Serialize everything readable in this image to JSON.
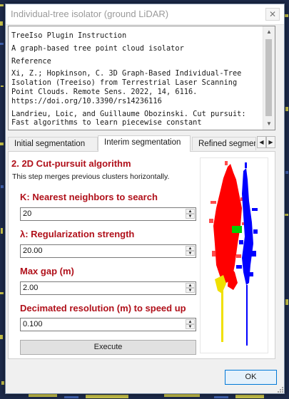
{
  "window": {
    "title": "Individual-tree isolator (ground LiDAR)",
    "close_glyph": "✕"
  },
  "info": {
    "lines": [
      "TreeIso Plugin Instruction",
      "A graph-based tree point cloud isolator",
      "Reference",
      "Xi, Z.; Hopkinson, C. 3D Graph-Based Individual-Tree Isolation (Treeiso) from Terrestrial Laser Scanning Point Clouds. Remote Sens. 2022, 14, 6116. https://doi.org/10.3390/rs14236116",
      "Landrieu, Loic, and Guillaume Obozinski. Cut pursuit: Fast algorithms to learn piecewise constant"
    ]
  },
  "tabs": [
    {
      "label": "Initial segmentation",
      "active": false
    },
    {
      "label": "Interim segmentation",
      "active": true
    },
    {
      "label": "Refined segmentation",
      "active": false
    }
  ],
  "panel": {
    "heading": "2. 2D Cut-pursuit algorithm",
    "description": "This step merges previous clusters horizontally.",
    "fields": [
      {
        "label": "K: Nearest neighbors to search",
        "value": "20"
      },
      {
        "label": "λ: Regularization strength",
        "value": "20.00"
      },
      {
        "label": "Max gap (m)",
        "value": "2.00"
      },
      {
        "label": "Decimated resolution (m) to speed up",
        "value": "0.100"
      }
    ],
    "execute_label": "Execute",
    "preview_icon": "tree-point-cloud-preview",
    "colors": {
      "red_tree": "#ff0000",
      "blue_tree": "#0000ff",
      "yellow_base": "#f0e000",
      "green_merge": "#00d000",
      "heading": "#b0101a"
    }
  },
  "footer": {
    "ok_label": "OK"
  }
}
